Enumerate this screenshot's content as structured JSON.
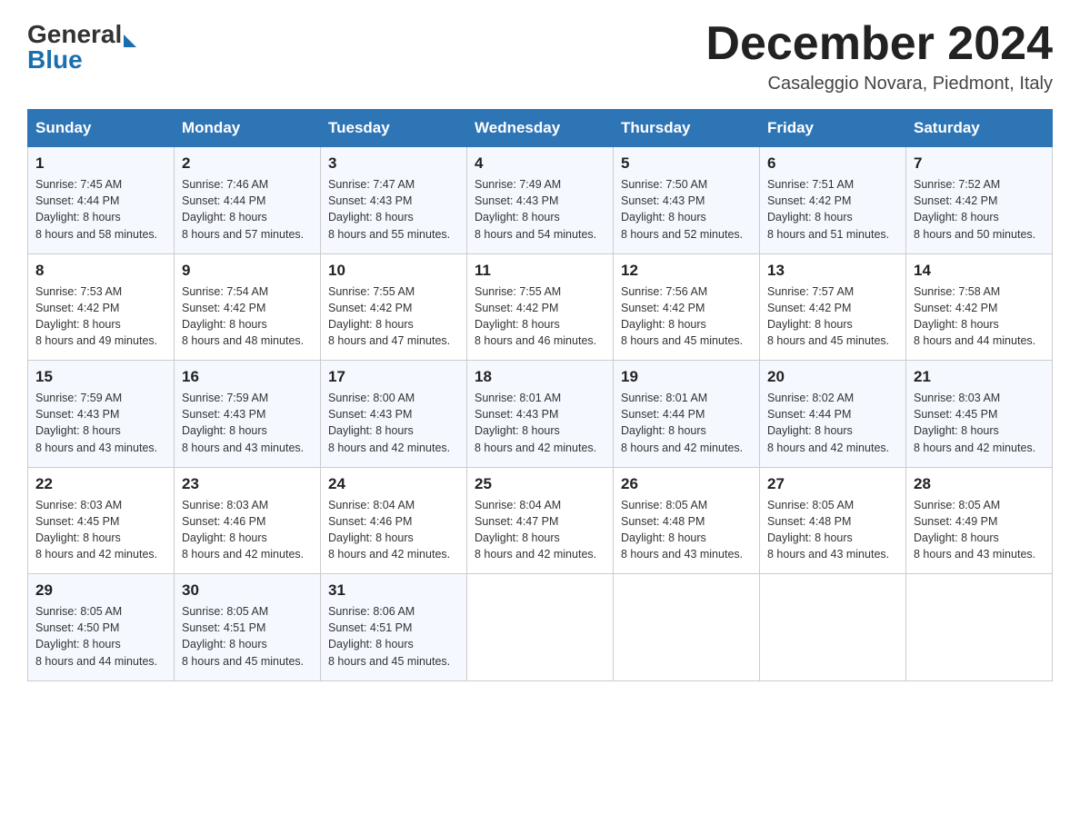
{
  "header": {
    "logo_general": "General",
    "logo_blue": "Blue",
    "month_title": "December 2024",
    "location": "Casaleggio Novara, Piedmont, Italy"
  },
  "weekdays": [
    "Sunday",
    "Monday",
    "Tuesday",
    "Wednesday",
    "Thursday",
    "Friday",
    "Saturday"
  ],
  "weeks": [
    [
      {
        "day": "1",
        "sunrise": "7:45 AM",
        "sunset": "4:44 PM",
        "daylight": "8 hours and 58 minutes."
      },
      {
        "day": "2",
        "sunrise": "7:46 AM",
        "sunset": "4:44 PM",
        "daylight": "8 hours and 57 minutes."
      },
      {
        "day": "3",
        "sunrise": "7:47 AM",
        "sunset": "4:43 PM",
        "daylight": "8 hours and 55 minutes."
      },
      {
        "day": "4",
        "sunrise": "7:49 AM",
        "sunset": "4:43 PM",
        "daylight": "8 hours and 54 minutes."
      },
      {
        "day": "5",
        "sunrise": "7:50 AM",
        "sunset": "4:43 PM",
        "daylight": "8 hours and 52 minutes."
      },
      {
        "day": "6",
        "sunrise": "7:51 AM",
        "sunset": "4:42 PM",
        "daylight": "8 hours and 51 minutes."
      },
      {
        "day": "7",
        "sunrise": "7:52 AM",
        "sunset": "4:42 PM",
        "daylight": "8 hours and 50 minutes."
      }
    ],
    [
      {
        "day": "8",
        "sunrise": "7:53 AM",
        "sunset": "4:42 PM",
        "daylight": "8 hours and 49 minutes."
      },
      {
        "day": "9",
        "sunrise": "7:54 AM",
        "sunset": "4:42 PM",
        "daylight": "8 hours and 48 minutes."
      },
      {
        "day": "10",
        "sunrise": "7:55 AM",
        "sunset": "4:42 PM",
        "daylight": "8 hours and 47 minutes."
      },
      {
        "day": "11",
        "sunrise": "7:55 AM",
        "sunset": "4:42 PM",
        "daylight": "8 hours and 46 minutes."
      },
      {
        "day": "12",
        "sunrise": "7:56 AM",
        "sunset": "4:42 PM",
        "daylight": "8 hours and 45 minutes."
      },
      {
        "day": "13",
        "sunrise": "7:57 AM",
        "sunset": "4:42 PM",
        "daylight": "8 hours and 45 minutes."
      },
      {
        "day": "14",
        "sunrise": "7:58 AM",
        "sunset": "4:42 PM",
        "daylight": "8 hours and 44 minutes."
      }
    ],
    [
      {
        "day": "15",
        "sunrise": "7:59 AM",
        "sunset": "4:43 PM",
        "daylight": "8 hours and 43 minutes."
      },
      {
        "day": "16",
        "sunrise": "7:59 AM",
        "sunset": "4:43 PM",
        "daylight": "8 hours and 43 minutes."
      },
      {
        "day": "17",
        "sunrise": "8:00 AM",
        "sunset": "4:43 PM",
        "daylight": "8 hours and 42 minutes."
      },
      {
        "day": "18",
        "sunrise": "8:01 AM",
        "sunset": "4:43 PM",
        "daylight": "8 hours and 42 minutes."
      },
      {
        "day": "19",
        "sunrise": "8:01 AM",
        "sunset": "4:44 PM",
        "daylight": "8 hours and 42 minutes."
      },
      {
        "day": "20",
        "sunrise": "8:02 AM",
        "sunset": "4:44 PM",
        "daylight": "8 hours and 42 minutes."
      },
      {
        "day": "21",
        "sunrise": "8:03 AM",
        "sunset": "4:45 PM",
        "daylight": "8 hours and 42 minutes."
      }
    ],
    [
      {
        "day": "22",
        "sunrise": "8:03 AM",
        "sunset": "4:45 PM",
        "daylight": "8 hours and 42 minutes."
      },
      {
        "day": "23",
        "sunrise": "8:03 AM",
        "sunset": "4:46 PM",
        "daylight": "8 hours and 42 minutes."
      },
      {
        "day": "24",
        "sunrise": "8:04 AM",
        "sunset": "4:46 PM",
        "daylight": "8 hours and 42 minutes."
      },
      {
        "day": "25",
        "sunrise": "8:04 AM",
        "sunset": "4:47 PM",
        "daylight": "8 hours and 42 minutes."
      },
      {
        "day": "26",
        "sunrise": "8:05 AM",
        "sunset": "4:48 PM",
        "daylight": "8 hours and 43 minutes."
      },
      {
        "day": "27",
        "sunrise": "8:05 AM",
        "sunset": "4:48 PM",
        "daylight": "8 hours and 43 minutes."
      },
      {
        "day": "28",
        "sunrise": "8:05 AM",
        "sunset": "4:49 PM",
        "daylight": "8 hours and 43 minutes."
      }
    ],
    [
      {
        "day": "29",
        "sunrise": "8:05 AM",
        "sunset": "4:50 PM",
        "daylight": "8 hours and 44 minutes."
      },
      {
        "day": "30",
        "sunrise": "8:05 AM",
        "sunset": "4:51 PM",
        "daylight": "8 hours and 45 minutes."
      },
      {
        "day": "31",
        "sunrise": "8:06 AM",
        "sunset": "4:51 PM",
        "daylight": "8 hours and 45 minutes."
      },
      null,
      null,
      null,
      null
    ]
  ],
  "labels": {
    "sunrise": "Sunrise:",
    "sunset": "Sunset:",
    "daylight": "Daylight:"
  }
}
